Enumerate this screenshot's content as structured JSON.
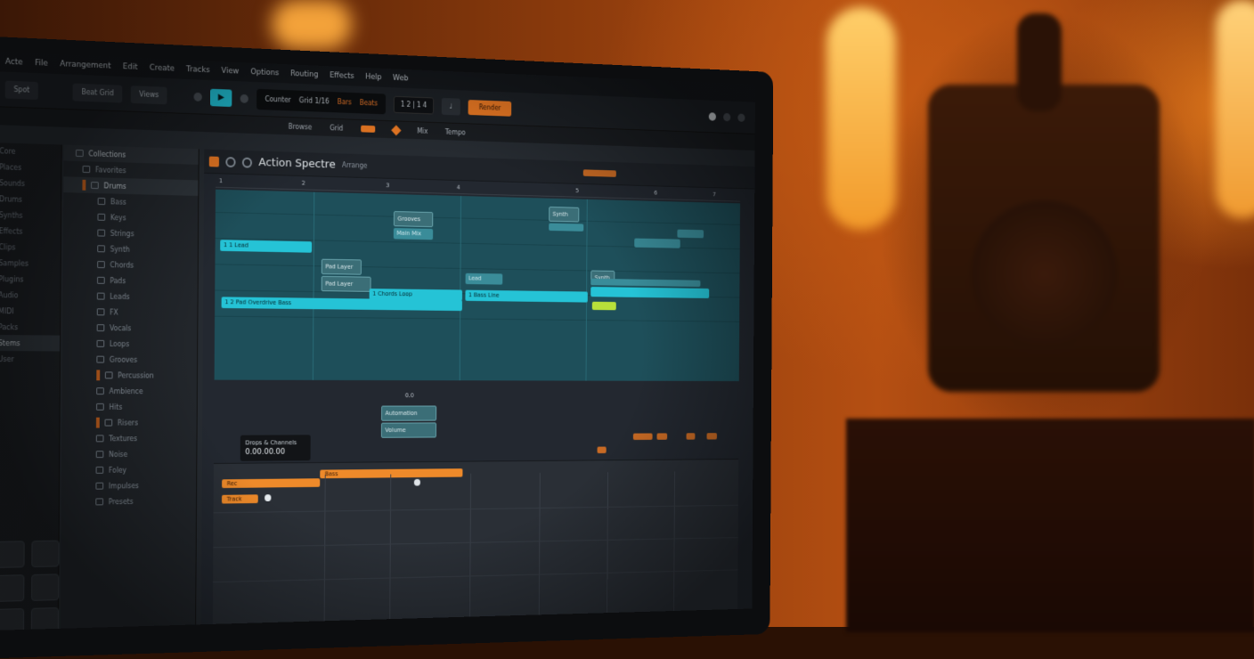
{
  "menu": [
    "Acte",
    "File",
    "Arrangement",
    "Edit",
    "Create",
    "Tracks",
    "View",
    "Options",
    "Routing",
    "Effects",
    "Help",
    "Web"
  ],
  "toolbar": {
    "btn1": "Spot",
    "btn2": "Beat Grid",
    "btn3": "Views",
    "lcd": [
      "Counter",
      "Grid 1/16",
      "Bars",
      "Beats"
    ],
    "tempo": "1 2 | 1 4",
    "orange_btn": "Render"
  },
  "subbar": [
    "Browse",
    "Grid",
    "Mix",
    "Tempo"
  ],
  "browser_rows": [
    "Core",
    "Places",
    "Sounds",
    "Drums",
    "Synths",
    "Effects",
    "Clips",
    "Samples",
    "Plugins",
    "Audio",
    "MIDI",
    "Packs",
    "Stems",
    "User"
  ],
  "tree": {
    "header": "Collections",
    "items": [
      "Favorites",
      "Drums",
      "Bass",
      "Keys",
      "Strings",
      "Synth",
      "Chords",
      "Pads",
      "Leads",
      "FX",
      "Vocals",
      "Loops",
      "Grooves",
      "Percussion",
      "Ambience",
      "Hits",
      "Risers",
      "Textures",
      "Noise",
      "Foley",
      "Impulses",
      "Presets"
    ]
  },
  "arrangement": {
    "title": "Action Spectre",
    "subtitle": "Arrange",
    "ruler": [
      "1",
      "2",
      "3",
      "4",
      "5",
      "6",
      "7"
    ],
    "clips": [
      {
        "label": "Grooves",
        "kind": "box"
      },
      {
        "label": "Main Mix",
        "kind": "dim"
      },
      {
        "label": "1 1 Lead",
        "kind": "bright"
      },
      {
        "label": "Pad Layer",
        "kind": "box"
      },
      {
        "label": "Pad Layer",
        "kind": "box"
      },
      {
        "label": "1 2 Pad Overdrive Bass",
        "kind": "bright"
      },
      {
        "label": "1 Chords Loop",
        "kind": "bright"
      },
      {
        "label": "1 Bass Line",
        "kind": "bright"
      },
      {
        "label": "Lead",
        "kind": "dim"
      },
      {
        "label": "Synth",
        "kind": "box"
      },
      {
        "label": "Synth",
        "kind": "box"
      }
    ],
    "info": {
      "line1": "Drops & Channels",
      "line2": "0.00.00.00"
    },
    "marker": "0.0",
    "sub_clips": [
      "Automation",
      "Volume"
    ]
  },
  "editor": {
    "bar1": "Rec",
    "bar2": "Bass",
    "bar3": "Track"
  },
  "colors": {
    "accent_cyan": "#25c3d6",
    "accent_orange": "#ec7a24",
    "accent_lime": "#b7e03a"
  }
}
